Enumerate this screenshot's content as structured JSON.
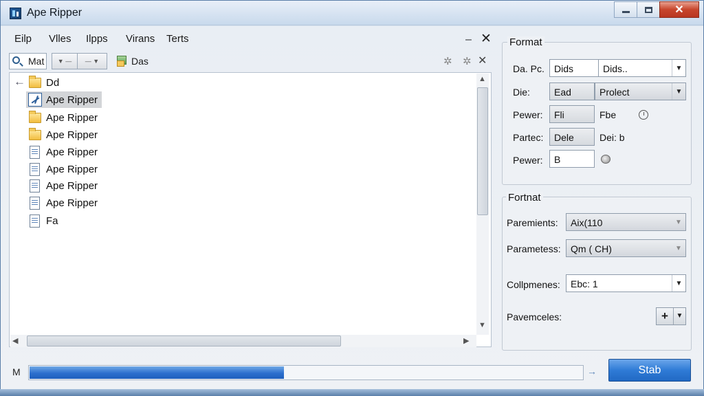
{
  "window": {
    "title": "Ape Ripper",
    "minimize_glyph": "minimize-icon",
    "maximize_glyph": "maximize-icon",
    "close_label": "✕"
  },
  "menu": {
    "items": [
      "Eilp",
      "Vlles",
      "Ilpps",
      "Virans",
      "Terts"
    ],
    "pane_minimize": "–",
    "pane_close": "✕"
  },
  "toolbar": {
    "search_text": "Mat",
    "location_label": "Das",
    "symbol_1": "✲",
    "symbol_2": "✲",
    "close": "✕"
  },
  "tree": {
    "back_arrow": "←",
    "rows": [
      {
        "label": "Dd",
        "icon": "folder-icon",
        "selected": false
      },
      {
        "label": "Ape Ripper",
        "icon": "app-icon",
        "selected": true
      },
      {
        "label": "Ape Ripper",
        "icon": "folder-icon",
        "selected": false
      },
      {
        "label": "Ape Ripper",
        "icon": "folder-icon",
        "selected": false
      },
      {
        "label": "Ape Ripper",
        "icon": "document-icon",
        "selected": false
      },
      {
        "label": "Ape Ripper",
        "icon": "document-icon",
        "selected": false
      },
      {
        "label": "Ape Ripper",
        "icon": "document-icon",
        "selected": false
      },
      {
        "label": "Ape Ripper",
        "icon": "document-icon",
        "selected": false
      },
      {
        "label": "Fa",
        "icon": "document-icon",
        "selected": false
      }
    ]
  },
  "format_group": {
    "title": "Format",
    "rows": [
      {
        "label": "Da. Pc.",
        "field": "Dids",
        "dropdown": "Dids.."
      },
      {
        "label": "Die:",
        "field": "Ead",
        "dropdown": "Prolect"
      },
      {
        "label": "Pewer:",
        "field": "Fli",
        "value": "Fbe"
      },
      {
        "label": "Partec:",
        "field": "Dele",
        "value": "Dei: b"
      },
      {
        "label": "Pewer:",
        "field": "B"
      }
    ]
  },
  "format2_group": {
    "title": "Fortnat",
    "rows": [
      {
        "label": "Paremients:",
        "dropdown": "Aix(110"
      },
      {
        "label": "Parametess:",
        "dropdown": "Qm ( CH)"
      },
      {
        "label": "Collpmenes:",
        "dropdown": "Ebc: 1"
      },
      {
        "label": "Pavemceles:",
        "button": "+"
      }
    ]
  },
  "status": {
    "label": "M",
    "progress_percent": 46,
    "arrow": "→",
    "start_label": "Stab"
  },
  "colors": {
    "accent": "#2f7bd6",
    "close_red": "#c7452c",
    "selection": "#d3d5d8"
  }
}
